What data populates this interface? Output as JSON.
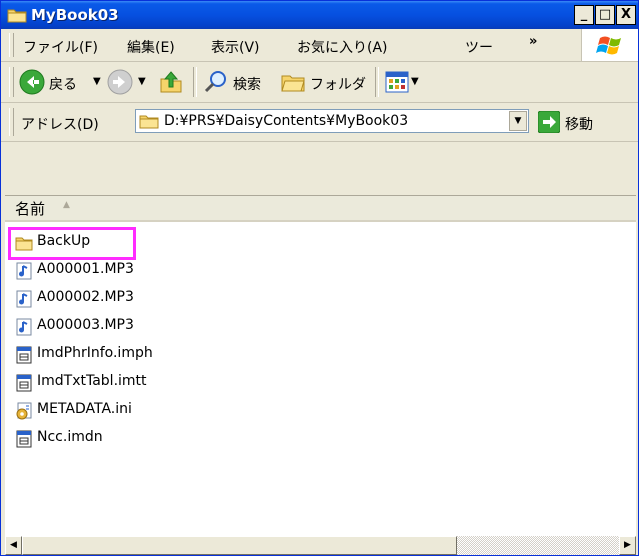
{
  "window": {
    "title": "MyBook03",
    "title_icon": "folder-icon",
    "controls": {
      "minimize": "_",
      "maximize": "□",
      "close": "X"
    }
  },
  "menu": {
    "items": [
      {
        "label": "ファイル(F)"
      },
      {
        "label": "編集(E)"
      },
      {
        "label": "表示(V)"
      },
      {
        "label": "お気に入り(A)"
      },
      {
        "label": "ツー"
      }
    ],
    "overflow": "»"
  },
  "toolbar": {
    "back_label": "戻る",
    "search_label": "検索",
    "folders_label": "フォルダ"
  },
  "address": {
    "label": "アドレス(D)",
    "value": "D:¥PRS¥DaisyContents¥MyBook03",
    "go_label": "移動"
  },
  "list": {
    "column_name": "名前",
    "items": [
      {
        "name": "BackUp",
        "icon": "folder-icon"
      },
      {
        "name": "A000001.MP3",
        "icon": "audio-file-icon"
      },
      {
        "name": "A000002.MP3",
        "icon": "audio-file-icon"
      },
      {
        "name": "A000003.MP3",
        "icon": "audio-file-icon"
      },
      {
        "name": "ImdPhrInfo.imph",
        "icon": "generic-file-icon"
      },
      {
        "name": "ImdTxtTabl.imtt",
        "icon": "generic-file-icon"
      },
      {
        "name": "METADATA.ini",
        "icon": "settings-file-icon"
      },
      {
        "name": "Ncc.imdn",
        "icon": "generic-file-icon"
      }
    ]
  },
  "colors": {
    "title_bar": "#0a5ae8",
    "highlight_box": "#ff2cff",
    "folder": "#f6d46b"
  }
}
